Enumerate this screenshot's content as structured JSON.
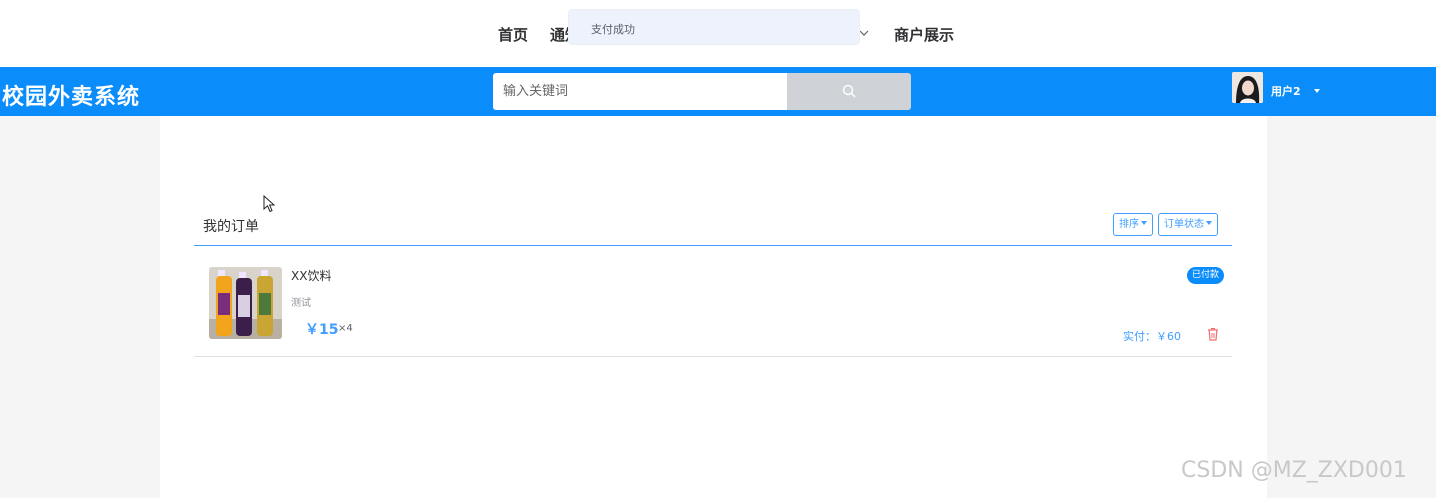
{
  "top_nav": {
    "items": [
      "首页",
      "通知",
      "商户展示"
    ]
  },
  "toast": {
    "message": "支付成功"
  },
  "header": {
    "logo": "校园外卖系统",
    "search_placeholder": "输入关键词",
    "user_name": "用户2"
  },
  "orders_section": {
    "title": "我的订单",
    "sort_label": "排序",
    "status_filter_label": "订单状态"
  },
  "orders": [
    {
      "name": "XX饮料",
      "description": "测试",
      "price": "￥15",
      "quantity": "×4",
      "status": "已付款",
      "paid_total": "实付：￥60"
    }
  ],
  "watermark": "CSDN @MZ_ZXD001",
  "colors": {
    "header_bg": "#0a8cfa",
    "accent": "#409eff",
    "toast_bg": "#edf2fc",
    "delete_red": "#f56c6c"
  }
}
